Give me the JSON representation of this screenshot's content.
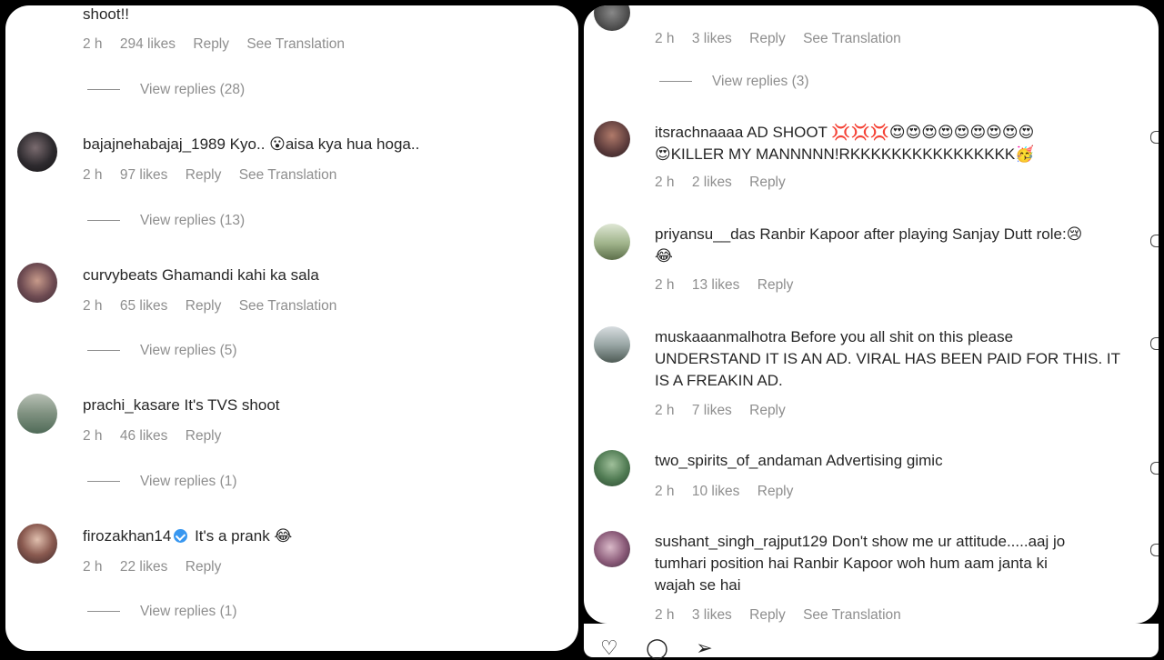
{
  "left": {
    "top_partial_text": "shoot!!",
    "top_meta": {
      "time": "2 h",
      "likes": "294 likes",
      "reply": "Reply",
      "translation": "See Translation"
    },
    "top_view_replies": "View replies (28)",
    "comments": [
      {
        "user": "bajajnehabajaj_1989",
        "text": "Kyo.. 😮aisa kya hua hoga..",
        "time": "2 h",
        "likes": "97 likes",
        "reply": "Reply",
        "translation": "See Translation",
        "view_replies": "View replies (13)"
      },
      {
        "user": "curvybeats",
        "text": "Ghamandi kahi ka sala",
        "time": "2 h",
        "likes": "65 likes",
        "reply": "Reply",
        "translation": "See Translation",
        "view_replies": "View replies (5)"
      },
      {
        "user": "prachi_kasare",
        "text": "It's TVS shoot",
        "time": "2 h",
        "likes": "46 likes",
        "reply": "Reply",
        "view_replies": "View replies (1)"
      },
      {
        "user": "firozakhan14",
        "text": "It's a prank 😂",
        "time": "2 h",
        "likes": "22 likes",
        "reply": "Reply",
        "view_replies": "View replies (1)"
      }
    ]
  },
  "right": {
    "top_meta": {
      "time": "2 h",
      "likes": "3 likes",
      "reply": "Reply",
      "translation": "See Translation"
    },
    "top_view_replies": "View replies (3)",
    "comments": [
      {
        "user": "itsrachnaaaa",
        "text_line1": "AD SHOOT 💢💢💢😍😍😍😍😍😍😍😍😍",
        "text_line2": "😍KILLER MY MANNNNN!RKKKKKKKKKKKKKKKK🥳",
        "time": "2 h",
        "likes": "2 likes",
        "reply": "Reply"
      },
      {
        "user": "priyansu__das",
        "text_line1": "Ranbir Kapoor after playing Sanjay Dutt role:😢",
        "text_line2": "😂",
        "time": "2 h",
        "likes": "13 likes",
        "reply": "Reply"
      },
      {
        "user": "muskaaanmalhotra",
        "text_line1": "Before you all shit on this please",
        "text_line2": "UNDERSTAND IT IS AN AD. VIRAL HAS BEEN PAID FOR THIS. IT",
        "text_line3": "IS A FREAKIN AD.",
        "time": "2 h",
        "likes": "7 likes",
        "reply": "Reply"
      },
      {
        "user": "two_spirits_of_andaman",
        "text_line1": "Advertising gimic",
        "time": "2 h",
        "likes": "10 likes",
        "reply": "Reply"
      },
      {
        "user": "sushant_singh_rajput129",
        "text_line1": "Don't show me ur attitude.....aaj jo",
        "text_line2": "tumhari position hai Ranbir Kapoor woh hum aam janta ki",
        "text_line3": "wajah se hai",
        "time": "2 h",
        "likes": "3 likes",
        "reply": "Reply",
        "translation": "See Translation"
      }
    ]
  },
  "colors": {
    "text": "#262626",
    "meta": "#8e8e8e",
    "verified": "#3897f0",
    "background": "#000000",
    "panel": "#ffffff"
  },
  "icons": [
    "verified-badge-icon",
    "heart-icon",
    "comment-icon",
    "share-icon"
  ]
}
